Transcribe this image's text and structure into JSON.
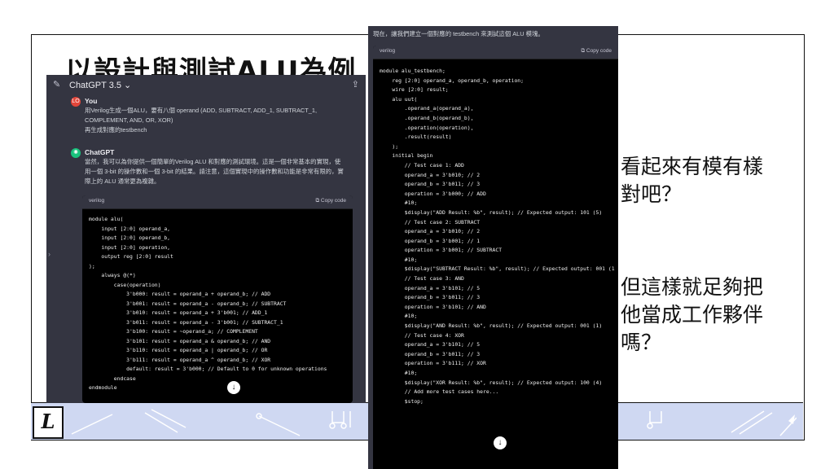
{
  "slide": {
    "title": "以設計與測試ALU為例",
    "side_text_1": [
      "看起來有模有樣",
      "對吧？"
    ],
    "side_text_2": [
      "但這樣就足夠把",
      "他當成工作夥伴",
      "嗎？"
    ],
    "footer_logo": "L"
  },
  "chat": {
    "model": "ChatGPT 3.5 ⌄",
    "user_initials": "LO",
    "user_name": "You",
    "user_message": [
      "用Verilog生成一個ALU，要有八個 operand (ADD, SUBTRACT, ADD_1, SUBTRACT_1,",
      "COMPLEMENT, AND, OR, XOR)",
      "再生成對應的testbench"
    ],
    "bot_name": "ChatGPT",
    "bot_message": [
      "當然，我可以為你提供一個簡單的Verilog ALU 和對應的測試環境。這是一個非常基本的實現，使",
      "用一個 3-bit 的操作數和一個 3-bit 的結果。請注意，這個實現中的操作數和功能是非常有限的，實",
      "際上的 ALU 通常更為複雜。"
    ],
    "code_lang": "verilog",
    "copy_label": "Copy code",
    "code": [
      "module alu(",
      "    input [2:0] operand_a,",
      "    input [2:0] operand_b,",
      "    input [2:0] operation,",
      "    output reg [2:0] result",
      ");",
      "",
      "    always @(*)",
      "        case(operation)",
      "            3'b000: result = operand_a + operand_b; // ADD",
      "            3'b001: result = operand_a - operand_b; // SUBTRACT",
      "            3'b010: result = operand_a + 3'b001; // ADD_1",
      "            3'b011: result = operand_a - 3'b001; // SUBTRACT_1",
      "            3'b100: result = ~operand_a; // COMPLEMENT",
      "            3'b101: result = operand_a & operand_b; // AND",
      "            3'b110: result = operand_a | operand_b; // OR",
      "            3'b111: result = operand_a ^ operand_b; // XOR",
      "            default: result = 3'b000; // Default to 0 for unknown operations",
      "        endcase",
      "",
      "endmodule"
    ]
  },
  "testbench": {
    "intro": "現在，讓我們建立一個對應的 testbench 來測試這個 ALU 模塊。",
    "code_lang": "verilog",
    "copy_label": "Copy code",
    "code": [
      "module alu_testbench;",
      "",
      "    reg [2:0] operand_a, operand_b, operation;",
      "    wire [2:0] result;",
      "",
      "    alu uut(",
      "        .operand_a(operand_a),",
      "        .operand_b(operand_b),",
      "        .operation(operation),",
      "        .result(result)",
      "    );",
      "",
      "    initial begin",
      "        // Test case 1: ADD",
      "        operand_a = 3'b010; // 2",
      "        operand_b = 3'b011; // 3",
      "        operation = 3'b000; // ADD",
      "        #10;",
      "        $display(\"ADD Result: %b\", result); // Expected output: 101 (5)",
      "",
      "        // Test case 2: SUBTRACT",
      "        operand_a = 3'b010; // 2",
      "        operand_b = 3'b001; // 1",
      "        operation = 3'b001; // SUBTRACT",
      "        #10;",
      "        $display(\"SUBTRACT Result: %b\", result); // Expected output: 001 (1",
      "",
      "        // Test case 3: AND",
      "        operand_a = 3'b101; // 5",
      "        operand_b = 3'b011; // 3",
      "        operation = 3'b101; // AND",
      "        #10;",
      "        $display(\"AND Result: %b\", result); // Expected output: 001 (1)",
      "",
      "        // Test case 4: XOR",
      "        operand_a = 3'b101; // 5",
      "        operand_b = 3'b011; // 3",
      "        operation = 3'b111; // XOR",
      "        #10;",
      "        $display(\"XOR Result: %b\", result); // Expected output: 100 (4)",
      "",
      "        // Add more test cases here...",
      "",
      "        $stop;"
    ]
  },
  "icons": {
    "edit": "edit-icon",
    "share": "share-icon",
    "copy": "copy-icon",
    "scroll": "arrow-down-icon"
  },
  "colors": {
    "user_avatar": "#e2463a",
    "bot_avatar": "#19c37d",
    "panel_bg": "#343541",
    "footer_bg": "#cfd8f2"
  }
}
